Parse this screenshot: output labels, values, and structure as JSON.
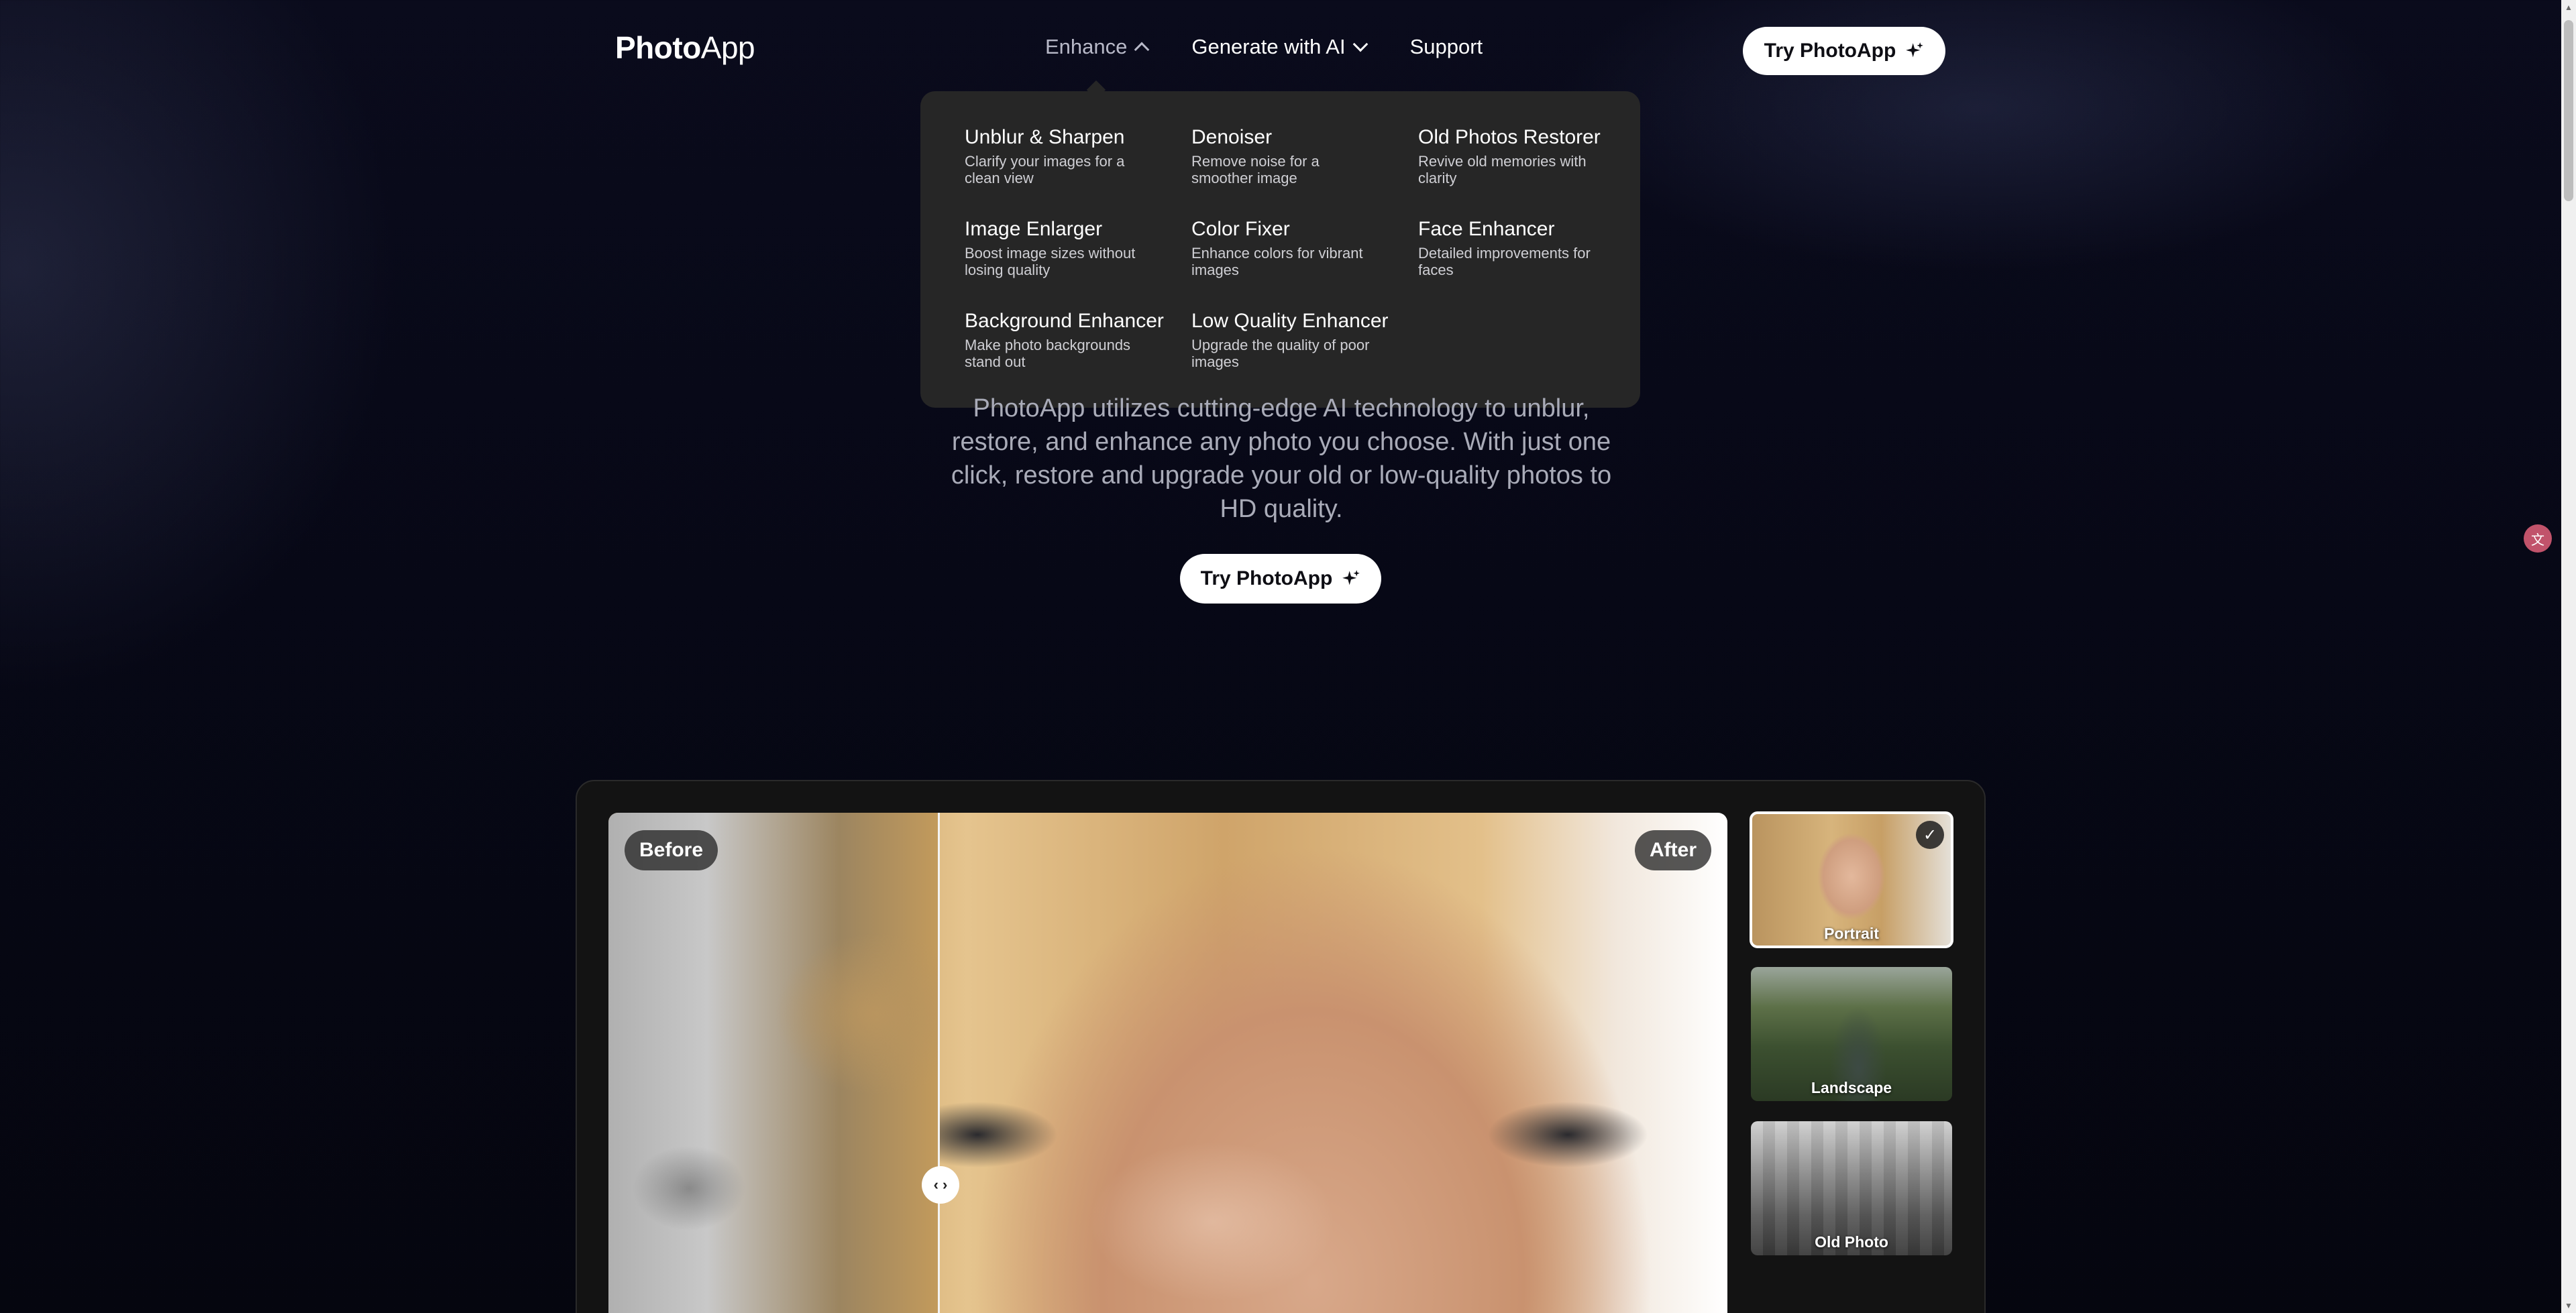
{
  "header": {
    "logo_bold": "Photo",
    "logo_light": "App",
    "nav": {
      "enhance": "Enhance",
      "generate": "Generate with AI",
      "support": "Support"
    },
    "cta": "Try PhotoApp"
  },
  "enhance_menu": [
    {
      "title": "Unblur & Sharpen",
      "desc": "Clarify your images for a clean view"
    },
    {
      "title": "Denoiser",
      "desc": "Remove noise for a smoother image"
    },
    {
      "title": "Old Photos Restorer",
      "desc": "Revive old memories with clarity"
    },
    {
      "title": "Image Enlarger",
      "desc": "Boost image sizes without losing quality"
    },
    {
      "title": "Color Fixer",
      "desc": "Enhance colors for vibrant images"
    },
    {
      "title": "Face Enhancer",
      "desc": "Detailed improvements for faces"
    },
    {
      "title": "Background Enhancer",
      "desc": "Make photo backgrounds stand out"
    },
    {
      "title": "Low Quality Enhancer",
      "desc": "Upgrade the quality of poor images"
    }
  ],
  "hero": {
    "text": "PhotoApp utilizes cutting-edge AI technology to unblur, restore, and enhance any photo you choose. With just one click, restore and upgrade your old or low-quality photos to HD quality.",
    "cta": "Try PhotoApp"
  },
  "comparison": {
    "before_label": "Before",
    "after_label": "After",
    "handle_glyph": "‹ ›",
    "split_fraction": 0.3
  },
  "samples": [
    {
      "label": "Portrait",
      "selected": true
    },
    {
      "label": "Landscape",
      "selected": false
    },
    {
      "label": "Old Photo",
      "selected": false
    }
  ],
  "icons": {
    "sparkle": "sparkle-icon",
    "check": "check-icon",
    "chevron_up": "chevron-up-icon",
    "chevron_down": "chevron-down-icon"
  },
  "colors": {
    "background": "#070816",
    "menu_bg": "#262626",
    "card_bg": "#131313",
    "button_bg": "#ffffff",
    "hero_text": "#a9abb8"
  }
}
